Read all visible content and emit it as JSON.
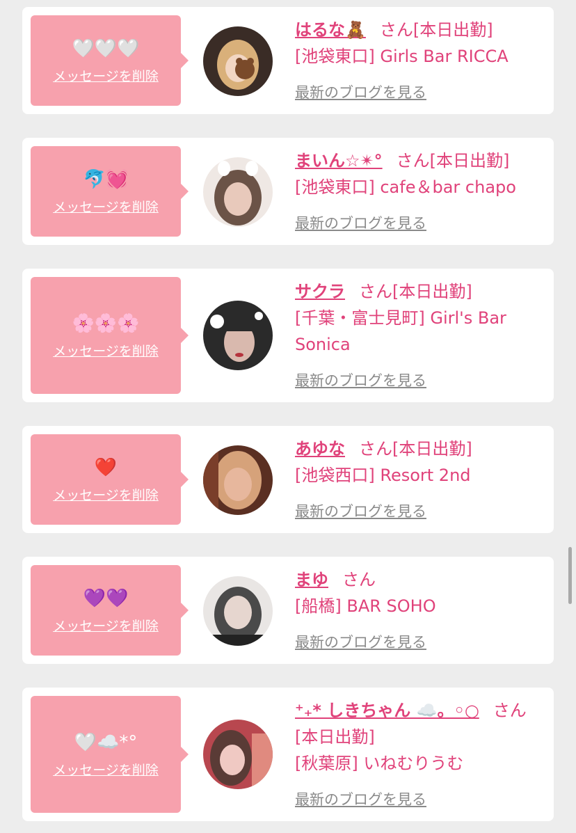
{
  "cards": [
    {
      "message_emoji": "🤍🤍🤍",
      "delete_label": "メッセージを削除",
      "name": "はるな🧸",
      "suffix": "さん",
      "status": "[本日出勤]",
      "shop": "[池袋東口] Girls Bar RICCA",
      "blog_label": "最新のブログを見る",
      "avatar_colors": [
        "#3a2c26",
        "#d9b07a"
      ]
    },
    {
      "message_emoji": "🐬💓",
      "delete_label": "メッセージを削除",
      "name": "まいん☆✴︎°",
      "suffix": "さん",
      "status": "[本日出勤]",
      "shop": "[池袋東口] cafe＆bar chapo",
      "blog_label": "最新のブログを見る",
      "avatar_colors": [
        "#6b5347",
        "#e8c9bb"
      ]
    },
    {
      "message_emoji": "🌸🌸🌸",
      "delete_label": "メッセージを削除",
      "name": "サクラ",
      "suffix": "さん",
      "status": "[本日出勤]",
      "shop": "[千葉・富士見町] Girl's Bar Sonica",
      "blog_label": "最新のブログを見る",
      "avatar_colors": [
        "#2a2a2a",
        "#d9b9ae"
      ]
    },
    {
      "message_emoji": "❤️",
      "delete_label": "メッセージを削除",
      "name": "あゆな",
      "suffix": "さん",
      "status": "[本日出勤]",
      "shop": "[池袋西口] Resort 2nd",
      "blog_label": "最新のブログを見る",
      "avatar_colors": [
        "#5a2f22",
        "#e7b79d"
      ]
    },
    {
      "message_emoji": "💜💜",
      "delete_label": "メッセージを削除",
      "name": "まゆ",
      "suffix": "さん",
      "status": "",
      "shop": "[船橋] BAR SOHO",
      "blog_label": "最新のブログを見る",
      "avatar_colors": [
        "#4a4a4a",
        "#e6d6cf"
      ]
    },
    {
      "message_emoji": "🤍☁️*°",
      "delete_label": "メッセージを削除",
      "name": "⁺₊* しきちゃん ☁️。◦○",
      "suffix": "さん",
      "status": "[本日出勤]",
      "shop": "[秋葉原] いねむりうむ",
      "blog_label": "最新のブログを見る",
      "avatar_colors": [
        "#b8474f",
        "#f0c9c3"
      ]
    }
  ]
}
